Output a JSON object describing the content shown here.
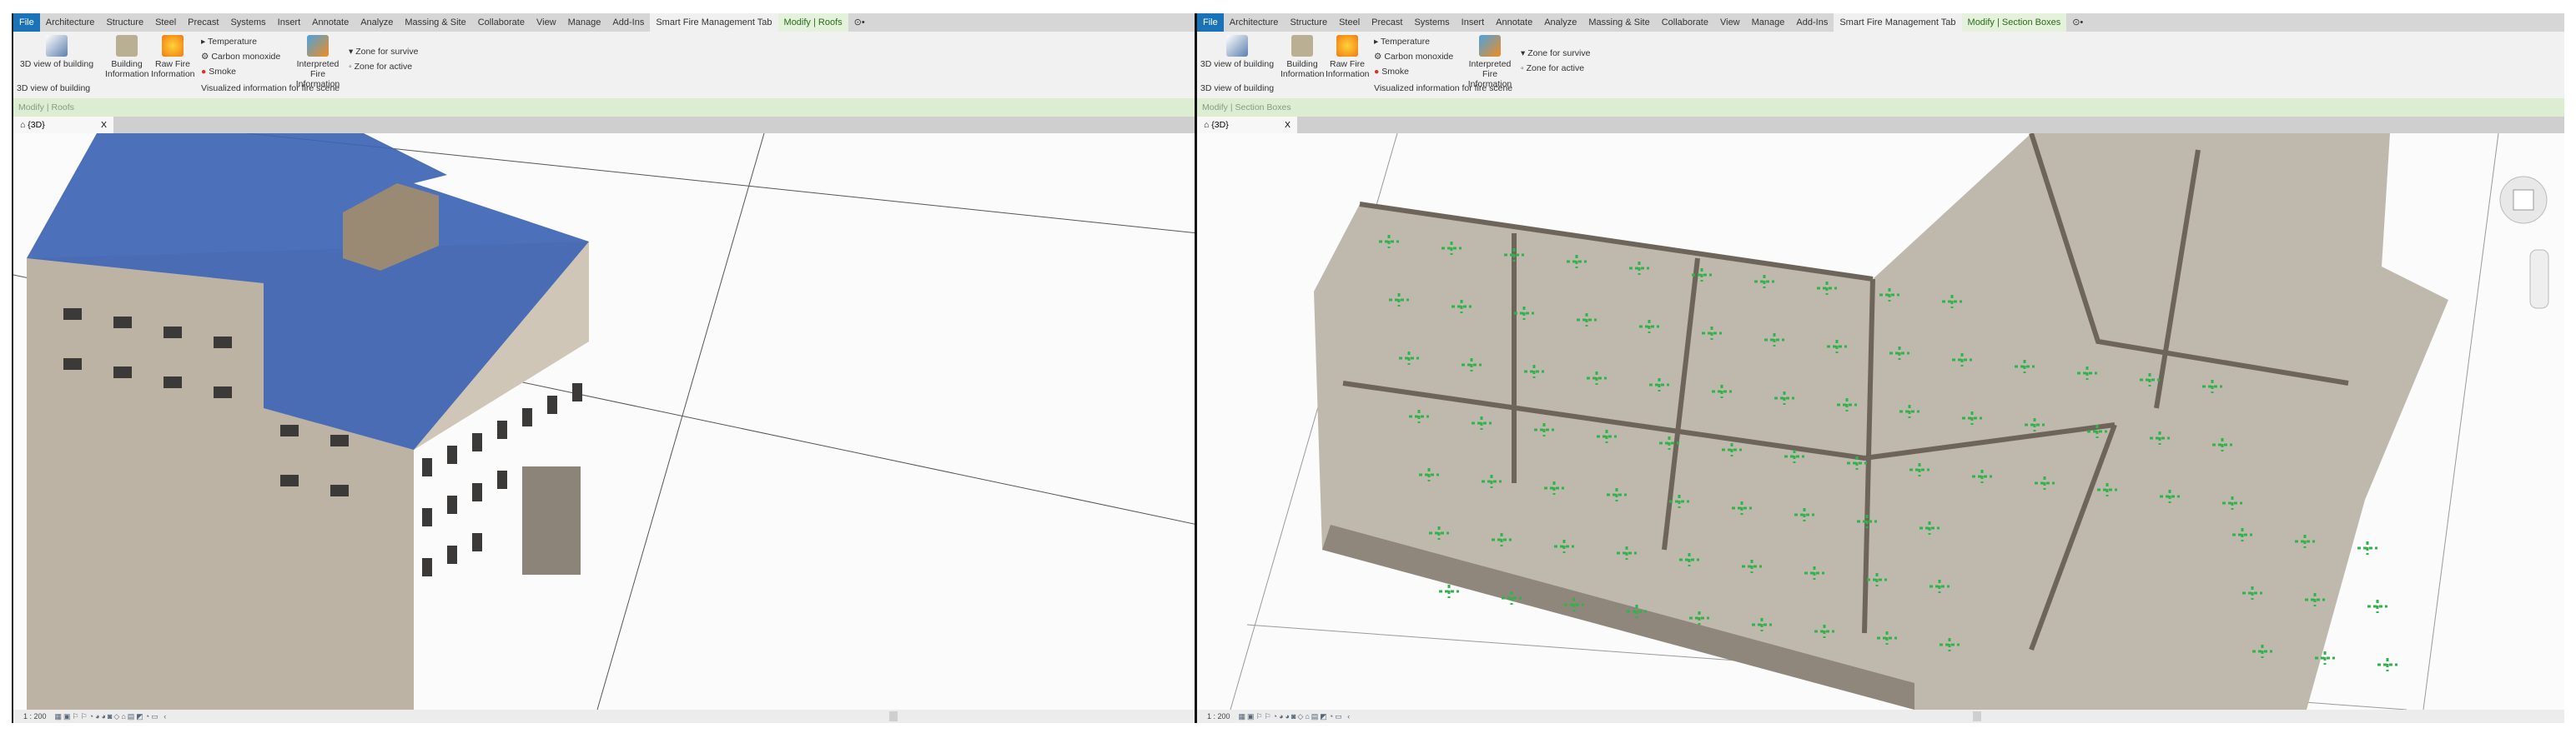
{
  "tabs": [
    "File",
    "Architecture",
    "Structure",
    "Steel",
    "Precast",
    "Systems",
    "Insert",
    "Annotate",
    "Analyze",
    "Massing & Site",
    "Collaborate",
    "View",
    "Manage",
    "Add-Ins",
    "Smart Fire Management Tab"
  ],
  "ribbon": {
    "view3d": "3D view of building",
    "building_info": "Building Information",
    "raw_fire": "Raw Fire Information",
    "options": [
      "Temperature",
      "Carbon monoxide",
      "Smoke"
    ],
    "interpreted": "Interpreted Fire Information",
    "zones": [
      "Zone for survive",
      "Zone for active"
    ],
    "group_3d": "3D view of building",
    "group_vis": "Visualized information for fire scene"
  },
  "left": {
    "context_tab": "Modify | Roofs",
    "context_bar": "Modify | Roofs",
    "view_tab": "{3D}",
    "scale": "1 : 200"
  },
  "right": {
    "context_tab": "Modify | Section Boxes",
    "context_bar": "Modify | Section Boxes",
    "view_tab": "{3D}",
    "scale": "1 : 200"
  },
  "close": "X",
  "extra_tab": "⊙•",
  "status_icons": "▦▣⚐⚐◔◕◕◙◇⌂▤◩◔▭ ‹",
  "colors": {
    "file": "#1a73b8",
    "roof": "#3e64b4",
    "context": "#dcedd2",
    "floor_marks": "#2fb34a"
  }
}
